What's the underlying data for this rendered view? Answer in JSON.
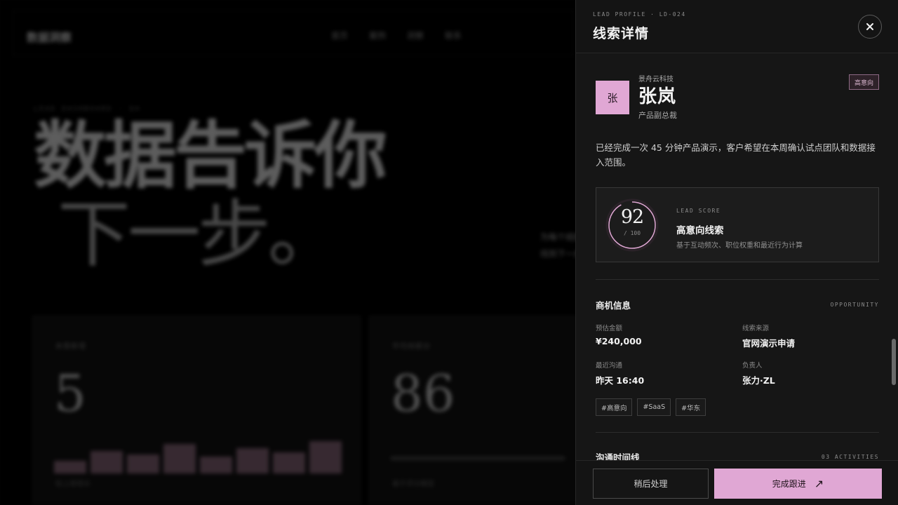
{
  "background": {
    "logo": "数据洞察",
    "nav": [
      "首页",
      "案例",
      "洞察",
      "联系"
    ],
    "kicker": "LEAD DASHBOARD · Q4",
    "hero_line1": "数据告诉你",
    "hero_line2": "下一步。",
    "side_text": "为每个线索找到下一步",
    "card1_label": "本周新增",
    "card1_value": "5",
    "card1_foot": "较上周增长",
    "card2_label": "平均线索分",
    "card2_value": "86",
    "card2_foot": "基于评分模型"
  },
  "drawer": {
    "eyebrow": "LEAD PROFILE · LD-024",
    "title": "线索详情",
    "close_label": "×",
    "lead": {
      "avatar_initial": "张",
      "company": "景舟云科技",
      "name": "张岚",
      "title": "产品副总裁",
      "badge": "高意向"
    },
    "summary": "已经完成一次 45 分钟产品演示，客户希望在本周确认试点团队和数据接入范围。",
    "score": {
      "value": "92",
      "max": "/ 100",
      "fraction": 0.92,
      "kicker": "LEAD SCORE",
      "title": "高意向线索",
      "description": "基于互动频次、职位权重和最近行为计算"
    },
    "opportunity": {
      "title": "商机信息",
      "kicker": "OPPORTUNITY",
      "fields": [
        {
          "label": "预估金额",
          "value": "¥240,000"
        },
        {
          "label": "线索来源",
          "value": "官网演示申请"
        },
        {
          "label": "最近沟通",
          "value": "昨天 16:40"
        },
        {
          "label": "负责人",
          "value": "张力·ZL"
        }
      ],
      "tags": [
        "#高意向",
        "#SaaS",
        "#华东"
      ]
    },
    "timeline": {
      "title": "沟通时间线",
      "kicker": "03 ACTIVITIES"
    },
    "actions": {
      "secondary": "稍后处理",
      "primary": "完成跟进",
      "primary_icon": "↗"
    }
  },
  "colors": {
    "accent": "#e0a7d4",
    "drawer_bg": "#161616"
  }
}
